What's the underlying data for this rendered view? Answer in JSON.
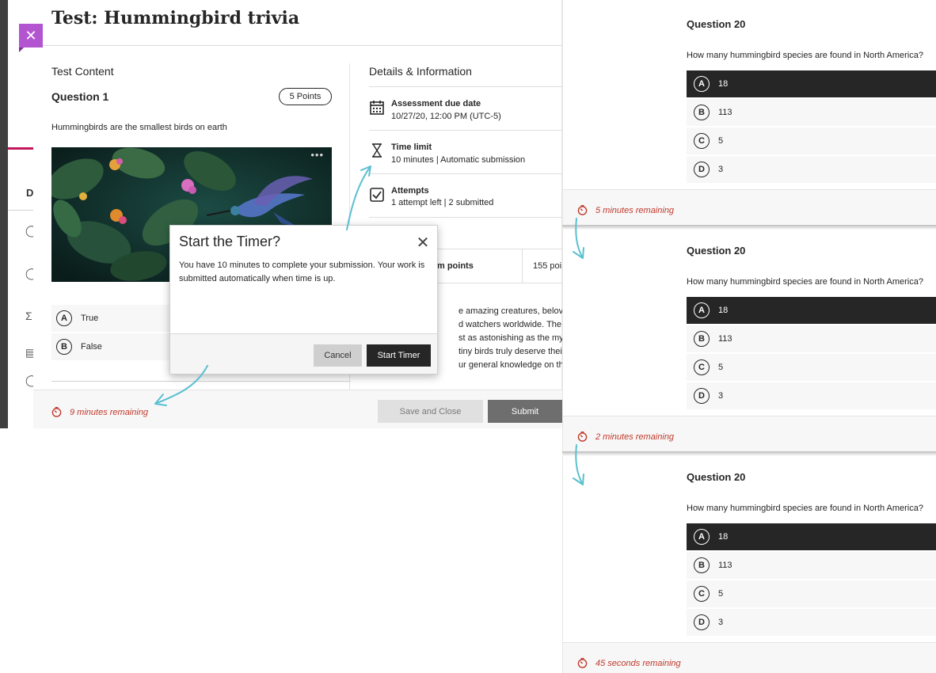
{
  "main": {
    "title": "Test: Hummingbird trivia",
    "content_section_label": "Test Content",
    "question_title": "Question 1",
    "points_badge": "5 Points",
    "question_text": "Hummingbirds are the smallest birds on earth",
    "answers": [
      {
        "letter": "A",
        "label": "True"
      },
      {
        "letter": "B",
        "label": "False"
      }
    ],
    "details_title": "Details & Information",
    "details": [
      {
        "heading": "Assessment due date",
        "value": "10/27/20, 12:00 PM (UTC-5)",
        "icon": "calendar-icon"
      },
      {
        "heading": "Time limit",
        "value": "10 minutes | Automatic submission",
        "icon": "hourglass-icon"
      },
      {
        "heading": "Attempts",
        "value": "1 attempt left | 2 submitted",
        "icon": "checkbox-icon"
      }
    ],
    "points_row_label": "m points",
    "points_row_value": "155 poi",
    "description_lines": [
      "e amazing creatures, beloved by",
      "d watchers worldwide. The facts",
      "st as astonishing as the myths,",
      "tiny birds truly deserve their sup",
      "ur general knowledge on them:"
    ],
    "timer": "9 minutes remaining",
    "save_label": "Save and Close",
    "submit_label": "Submit",
    "sidebar_letter": "D"
  },
  "modal": {
    "title": "Start the Timer?",
    "body": "You have 10 minutes to complete your submission. Your work is submitted automatically when time is up.",
    "cancel_label": "Cancel",
    "start_label": "Start Timer"
  },
  "panels": [
    {
      "question": "Question 20",
      "text": "How many hummingbird species are found in North America?",
      "options": [
        {
          "letter": "A",
          "label": "18",
          "selected": true
        },
        {
          "letter": "B",
          "label": "113",
          "selected": false
        },
        {
          "letter": "C",
          "label": "5",
          "selected": false
        },
        {
          "letter": "D",
          "label": "3",
          "selected": false
        }
      ],
      "timer": "5 minutes remaining"
    },
    {
      "question": "Question 20",
      "text": "How many hummingbird species are found in North America?",
      "options": [
        {
          "letter": "A",
          "label": "18",
          "selected": true
        },
        {
          "letter": "B",
          "label": "113",
          "selected": false
        },
        {
          "letter": "C",
          "label": "5",
          "selected": false
        },
        {
          "letter": "D",
          "label": "3",
          "selected": false
        }
      ],
      "timer": "2 minutes remaining"
    },
    {
      "question": "Question 20",
      "text": "How many hummingbird species are found in North America?",
      "options": [
        {
          "letter": "A",
          "label": "18",
          "selected": true
        },
        {
          "letter": "B",
          "label": "113",
          "selected": false
        },
        {
          "letter": "C",
          "label": "5",
          "selected": false
        },
        {
          "letter": "D",
          "label": "3",
          "selected": false
        }
      ],
      "timer": "45 seconds remaining"
    }
  ],
  "colors": {
    "accent_purple": "#b355d1",
    "timer_red": "#c0392b",
    "arrow_teal": "#5bbfd0",
    "selected_bg": "#262626"
  }
}
